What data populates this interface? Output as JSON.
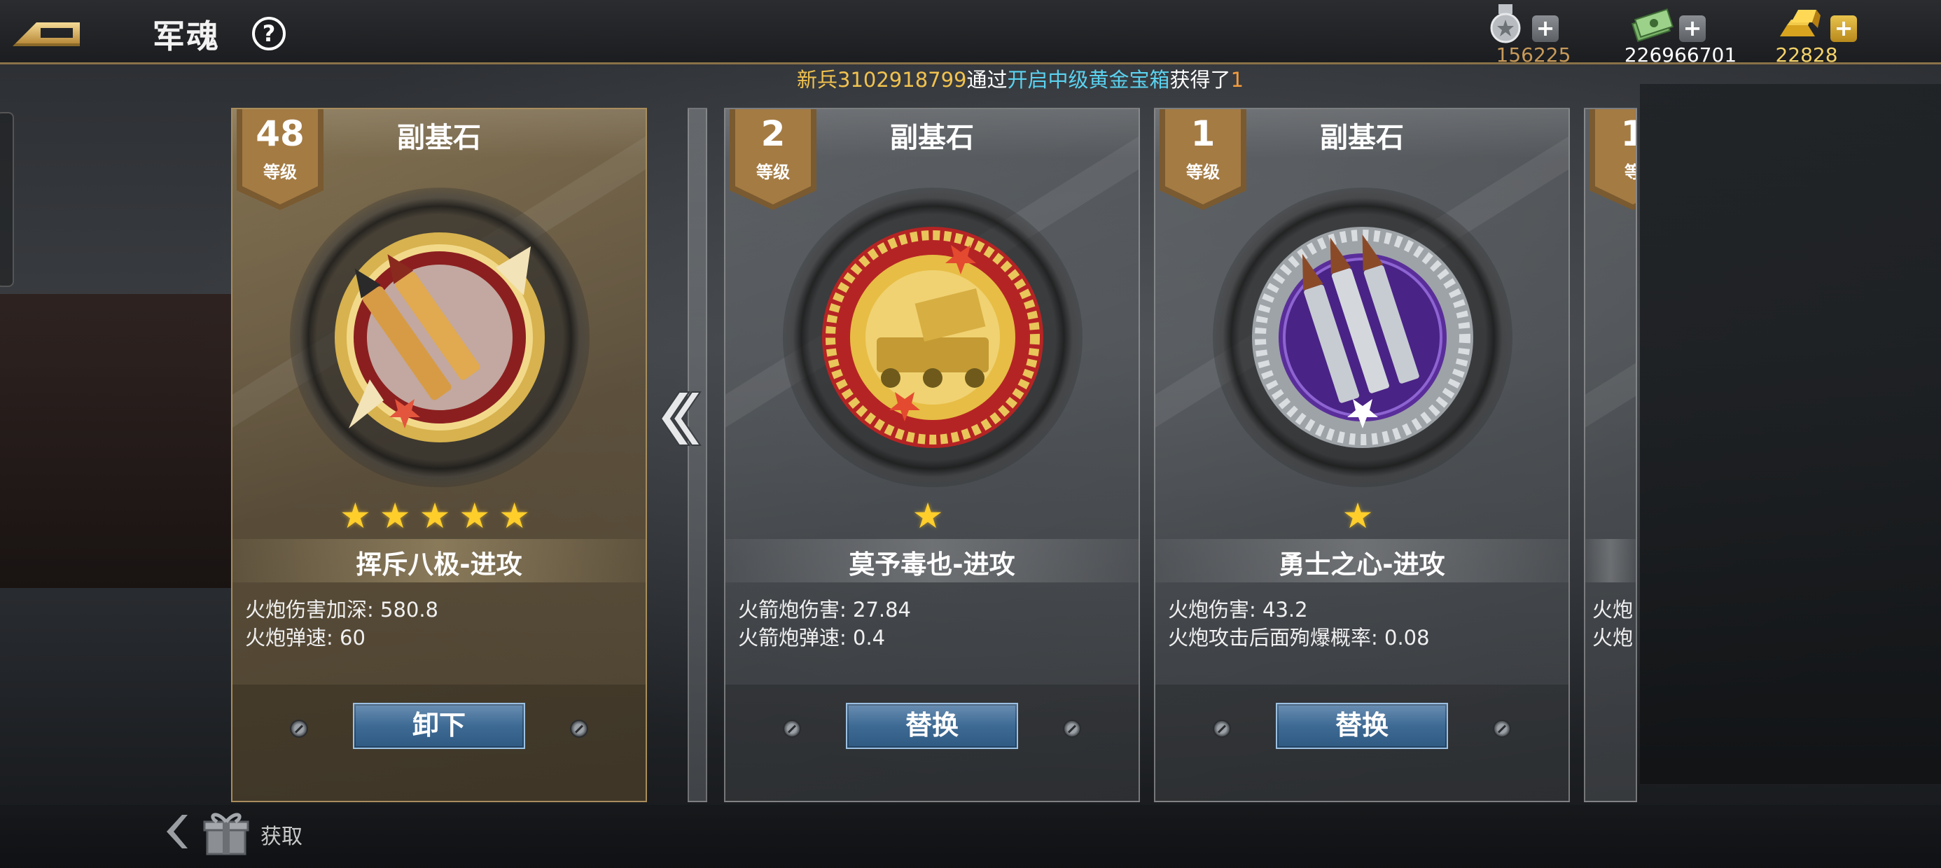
{
  "header": {
    "title": "军魂",
    "help_icon": "?"
  },
  "currencies": [
    {
      "name": "medal-icon",
      "value": "156225",
      "color": "#c89a5a"
    },
    {
      "name": "cash-icon",
      "value": "226966701",
      "color": "#ffffff"
    },
    {
      "name": "gold-bars-icon",
      "value": "22828",
      "color": "#f5d36a"
    }
  ],
  "ticker": {
    "part1": "新兵3102918799",
    "part2": "通过",
    "part3": "开启中级黄金宝箱",
    "part4": "获得了",
    "part5": "1"
  },
  "cards": [
    {
      "kind": "副基石",
      "level": "48",
      "level_label": "等级",
      "stars": "★★★★★",
      "star_count": 5,
      "name": "挥斥八极-进攻",
      "stats": [
        "火炮伤害加深: 580.8",
        "火炮弹速: 60"
      ],
      "action": "卸下",
      "selected": true
    },
    {
      "kind": "副基石",
      "level": "2",
      "level_label": "等级",
      "stars": "★",
      "star_count": 1,
      "name": "莫予毒也-进攻",
      "stats": [
        "火箭炮伤害: 27.84",
        "火箭炮弹速: 0.4"
      ],
      "action": "替换",
      "selected": false
    },
    {
      "kind": "副基石",
      "level": "1",
      "level_label": "等级",
      "stars": "★",
      "star_count": 1,
      "name": "勇士之心-进攻",
      "stats": [
        "火炮伤害: 43.2",
        "火炮攻击后面殉爆概率: 0.08"
      ],
      "action": "替换",
      "selected": false
    },
    {
      "kind": "",
      "level": "1",
      "level_label": "等",
      "stats": [
        "火炮",
        "火炮"
      ],
      "partial": true
    }
  ],
  "footer": {
    "acquire_label": "获取"
  },
  "colors": {
    "accent_gold": "#a88d5c",
    "button_blue": "#3d6a94",
    "star_yellow": "#ffce2b"
  }
}
